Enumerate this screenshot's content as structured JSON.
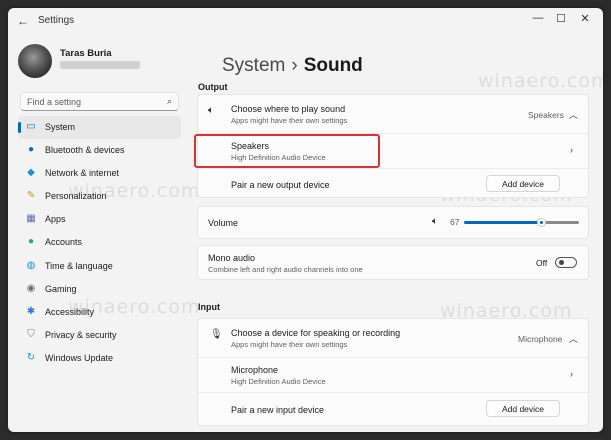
{
  "window": {
    "title": "Settings",
    "controls": {
      "minimize": "—",
      "maximize": "☐",
      "close": "✕"
    }
  },
  "profile": {
    "name": "Taras Buria"
  },
  "search": {
    "placeholder": "Find a setting"
  },
  "nav": [
    {
      "label": "System",
      "icon": "monitor-icon",
      "color": "#0a6cc4"
    },
    {
      "label": "Bluetooth & devices",
      "icon": "bluetooth-icon",
      "color": "#0a6cc4"
    },
    {
      "label": "Network & internet",
      "icon": "wifi-icon",
      "color": "#1a8fd6"
    },
    {
      "label": "Personalization",
      "icon": "brush-icon",
      "color": "#d08a2c"
    },
    {
      "label": "Apps",
      "icon": "apps-icon",
      "color": "#5b6fa8"
    },
    {
      "label": "Accounts",
      "icon": "person-icon",
      "color": "#2aa57b"
    },
    {
      "label": "Time & language",
      "icon": "globe-icon",
      "color": "#1a8fd6"
    },
    {
      "label": "Gaming",
      "icon": "gamepad-icon",
      "color": "#6f6f6f"
    },
    {
      "label": "Accessibility",
      "icon": "accessibility-icon",
      "color": "#2a7ad6"
    },
    {
      "label": "Privacy & security",
      "icon": "shield-icon",
      "color": "#6f7b88"
    },
    {
      "label": "Windows Update",
      "icon": "update-icon",
      "color": "#1a8fd6"
    }
  ],
  "breadcrumb": {
    "parent": "System",
    "separator": "›",
    "current": "Sound"
  },
  "output": {
    "section_label": "Output",
    "choose_title": "Choose where to play sound",
    "choose_sub": "Apps might have their own settings",
    "choose_value": "Speakers",
    "device_name": "Speakers",
    "device_sub": "High Definition Audio Device",
    "pair_label": "Pair a new output device",
    "add_button": "Add device"
  },
  "volume": {
    "label": "Volume",
    "value_text": "67",
    "level": 0.67
  },
  "mono": {
    "title": "Mono audio",
    "sub": "Combine left and right audio channels into one",
    "state": "Off"
  },
  "input": {
    "section_label": "Input",
    "choose_title": "Choose a device for speaking or recording",
    "choose_sub": "Apps might have their own settings",
    "choose_value": "Microphone",
    "device_name": "Microphone",
    "device_sub": "High Definition Audio Device",
    "pair_label": "Pair a new input device",
    "add_button": "Add device"
  },
  "watermark": "winaero.com",
  "colors": {
    "accent": "#0067c0",
    "highlight": "#d93232"
  }
}
